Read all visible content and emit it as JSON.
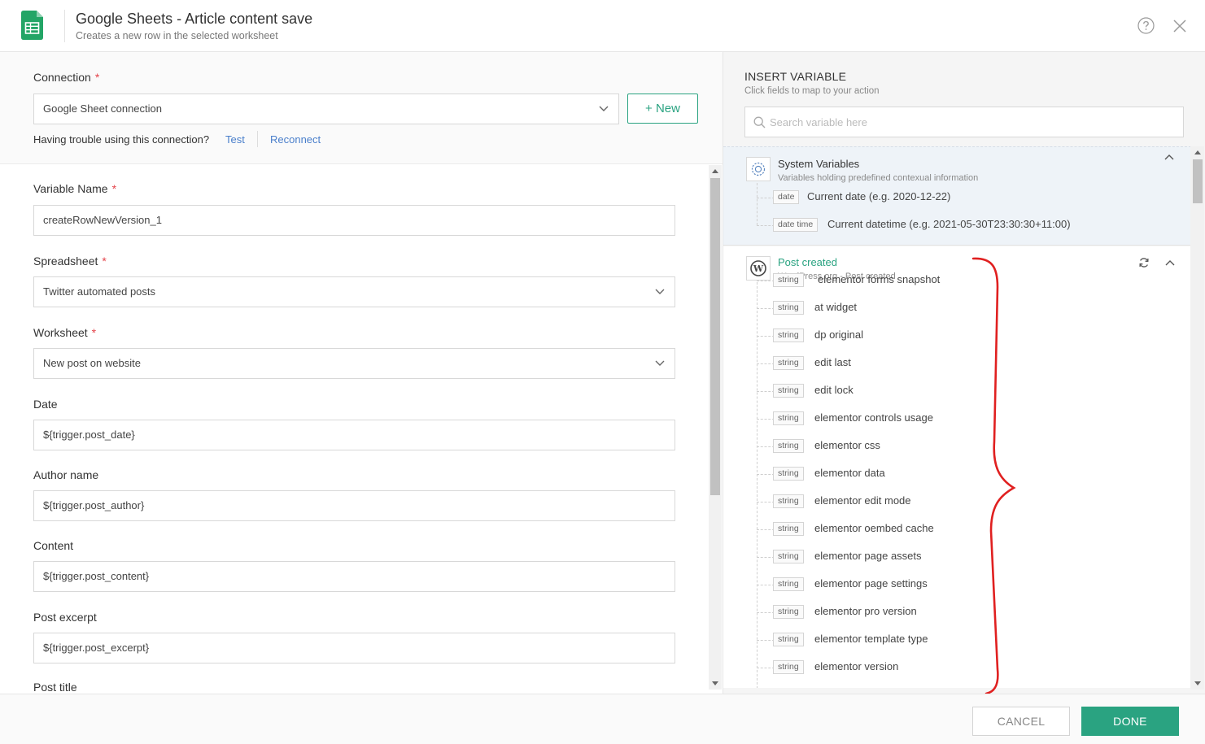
{
  "header": {
    "title": "Google Sheets - Article content save",
    "subtitle": "Creates a new row in the selected worksheet"
  },
  "connection": {
    "label": "Connection",
    "value": "Google Sheet connection",
    "new_button": "+ New",
    "trouble_text": "Having trouble using this connection?",
    "test_link": "Test",
    "reconnect_link": "Reconnect"
  },
  "form": {
    "variable_name": {
      "label": "Variable Name",
      "value": "createRowNewVersion_1"
    },
    "spreadsheet": {
      "label": "Spreadsheet",
      "value": "Twitter automated posts"
    },
    "worksheet": {
      "label": "Worksheet",
      "value": "New post on website"
    },
    "date": {
      "label": "Date",
      "value": "${trigger.post_date}"
    },
    "author_name": {
      "label": "Author name",
      "value": "${trigger.post_author}"
    },
    "content": {
      "label": "Content",
      "value": "${trigger.post_content}"
    },
    "post_excerpt": {
      "label": "Post excerpt",
      "value": "${trigger.post_excerpt}"
    },
    "post_title": {
      "label": "Post title"
    }
  },
  "required_mark": "*",
  "insert_variable": {
    "title": "INSERT VARIABLE",
    "subtitle": "Click fields to map to your action",
    "search_placeholder": "Search variable here",
    "system": {
      "title": "System Variables",
      "subtitle": "Variables holding predefined contexual information",
      "items": [
        {
          "type": "date",
          "label": "Current date (e.g. 2020-12-22)"
        },
        {
          "type": "date time",
          "label": "Current datetime (e.g. 2021-05-30T23:30:30+11:00)"
        }
      ]
    },
    "trigger": {
      "title": "Post created",
      "subtitle": "WordPress.org - Post created",
      "items": [
        {
          "type": "string",
          "label": "elementor forms snapshot"
        },
        {
          "type": "string",
          "label": "at widget"
        },
        {
          "type": "string",
          "label": "dp original"
        },
        {
          "type": "string",
          "label": "edit last"
        },
        {
          "type": "string",
          "label": "edit lock"
        },
        {
          "type": "string",
          "label": "elementor controls usage"
        },
        {
          "type": "string",
          "label": "elementor css"
        },
        {
          "type": "string",
          "label": "elementor data"
        },
        {
          "type": "string",
          "label": "elementor edit mode"
        },
        {
          "type": "string",
          "label": "elementor oembed cache"
        },
        {
          "type": "string",
          "label": "elementor page assets"
        },
        {
          "type": "string",
          "label": "elementor page settings"
        },
        {
          "type": "string",
          "label": "elementor pro version"
        },
        {
          "type": "string",
          "label": "elementor template type"
        },
        {
          "type": "string",
          "label": "elementor version"
        }
      ]
    }
  },
  "footer": {
    "cancel": "CANCEL",
    "done": "DONE"
  },
  "colors": {
    "accent": "#2aa381",
    "link": "#4a7fcb",
    "required": "#e4444b",
    "annotation": "#e02020"
  }
}
